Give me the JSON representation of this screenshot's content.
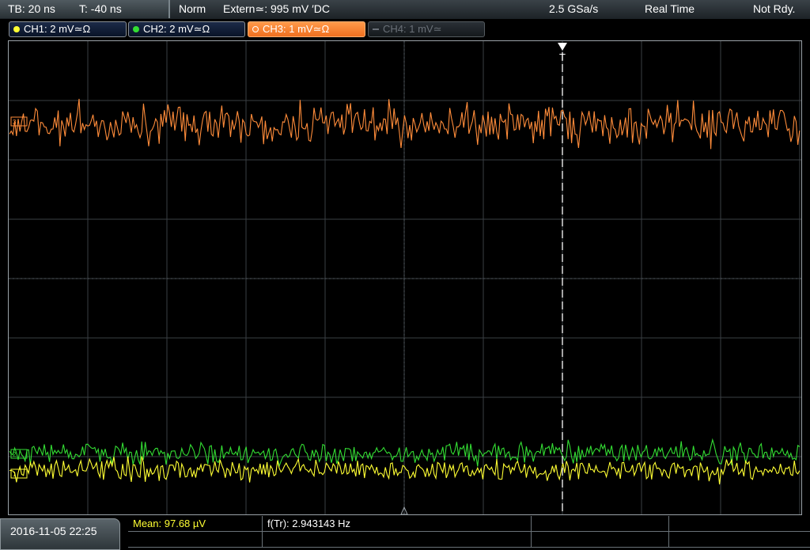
{
  "status": {
    "timebase": "TB: 20 ns",
    "trigger_pos": "T: -40 ns",
    "mode": "Norm",
    "trigger_source": "Extern≃: 995 mV ′DC",
    "sample_rate": "2.5 GSa/s",
    "acq_mode": "Real Time",
    "trigger_state": "Not Rdy."
  },
  "channels": [
    {
      "label": "CH1: 2 mV≃Ω",
      "color": "#ffff33",
      "state": "on"
    },
    {
      "label": "CH2: 2 mV≃Ω",
      "color": "#33dd33",
      "state": "on"
    },
    {
      "label": "CH3: 1 mV≃Ω",
      "color": "#ff8c3a",
      "state": "active"
    },
    {
      "label": "CH4: 1 mV≃",
      "color": "#6a7078",
      "state": "off"
    }
  ],
  "markers": {
    "trigger": "T"
  },
  "footer": {
    "datetime": "2016-11-05 22:25",
    "meas1": "Mean: 97.68 µV",
    "meas1_color": "#ffff33",
    "meas2": "f(Tr): 2.943143 Hz"
  },
  "colors": {
    "ch1": "#ffff33",
    "ch2": "#33dd33",
    "ch3": "#ff8c3a",
    "trigger_line": "#ffffff"
  }
}
